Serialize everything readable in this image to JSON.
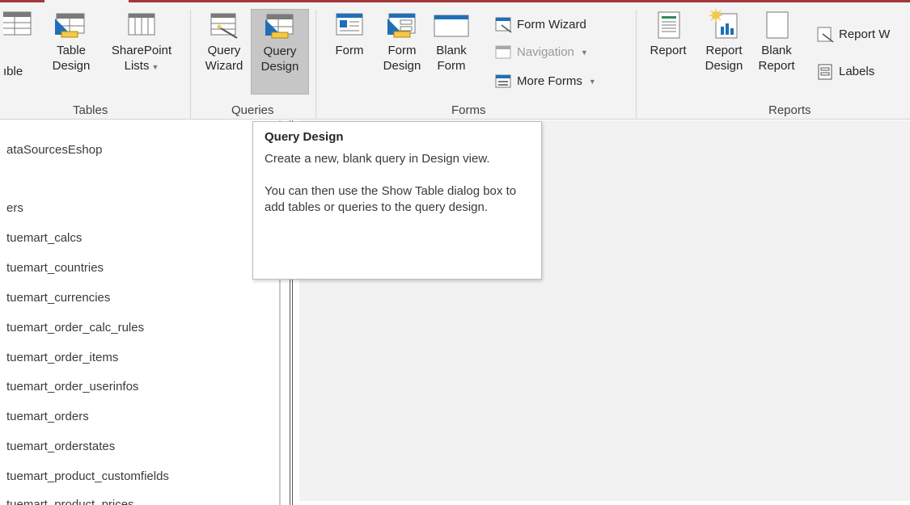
{
  "ribbon": {
    "groups": {
      "tables": "Tables",
      "queries": "Queries",
      "forms": "Forms",
      "reports": "Reports"
    },
    "tables": {
      "table": "ıble",
      "table_design": [
        "Table",
        "Design"
      ],
      "sharepoint": [
        "SharePoint",
        "Lists"
      ]
    },
    "queries": {
      "wizard": [
        "Query",
        "Wizard"
      ],
      "design": [
        "Query",
        "Design"
      ]
    },
    "forms": {
      "form": "Form",
      "form_design": [
        "Form",
        "Design"
      ],
      "blank_form": [
        "Blank",
        "Form"
      ],
      "form_wizard": "Form Wizard",
      "navigation": "Navigation",
      "more_forms": "More Forms"
    },
    "reports": {
      "report": "Report",
      "report_design": [
        "Report",
        "Design"
      ],
      "blank_report": [
        "Blank",
        "Report"
      ],
      "report_wizard": "Report W",
      "labels": "Labels"
    }
  },
  "nav": {
    "header": "ataSourcesEshop",
    "items": [
      "ers",
      "tuemart_calcs",
      "tuemart_countries",
      "tuemart_currencies",
      "tuemart_order_calc_rules",
      "tuemart_order_items",
      "tuemart_order_userinfos",
      "tuemart_orders",
      "tuemart_orderstates",
      "tuemart_product_customfields",
      "tuemart_product_prices"
    ]
  },
  "tooltip": {
    "title": "Query Design",
    "line1": "Create a new, blank query in Design view.",
    "line2": "You can then use the Show Table dialog box to add tables or queries to the query design."
  },
  "colors": {
    "accent": "#a4373a",
    "ribbon_bg": "#f3f3f3",
    "icon_blue": "#1f6fb8",
    "icon_border": "#7a7a7a"
  }
}
